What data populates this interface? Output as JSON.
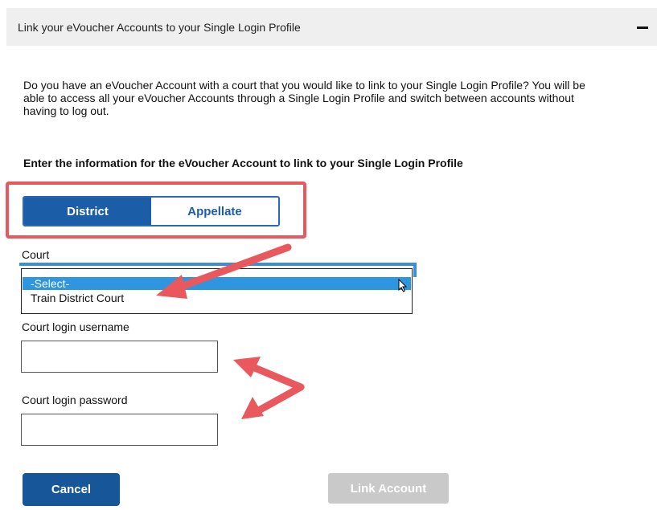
{
  "header": {
    "title": "Link your eVoucher Accounts to your Single Login Profile",
    "collapse_icon": "minus-icon"
  },
  "intro_text": "Do you have an eVoucher Account with a court that you would like to link to your Single Login Profile? You will be able to access all your eVoucher Accounts through a Single Login Profile and switch between accounts without having to log out.",
  "instruction": "Enter the information for the eVoucher Account to link to your Single Login Profile",
  "court_type_toggle": {
    "options": [
      "District",
      "Appellate"
    ],
    "selected": "District"
  },
  "court": {
    "label": "Court",
    "options": [
      "-Select-",
      "Train District Court"
    ],
    "highlighted": "-Select-"
  },
  "username": {
    "label": "Court login username",
    "value": "",
    "placeholder": ""
  },
  "password": {
    "label": "Court login password",
    "value": "",
    "placeholder": ""
  },
  "buttons": {
    "cancel": "Cancel",
    "link_account": "Link Account"
  },
  "colors": {
    "primary": "#1b5da6",
    "annotation": "#e8585c",
    "disabled": "#c9c9c9",
    "selection": "#2e96e0"
  }
}
